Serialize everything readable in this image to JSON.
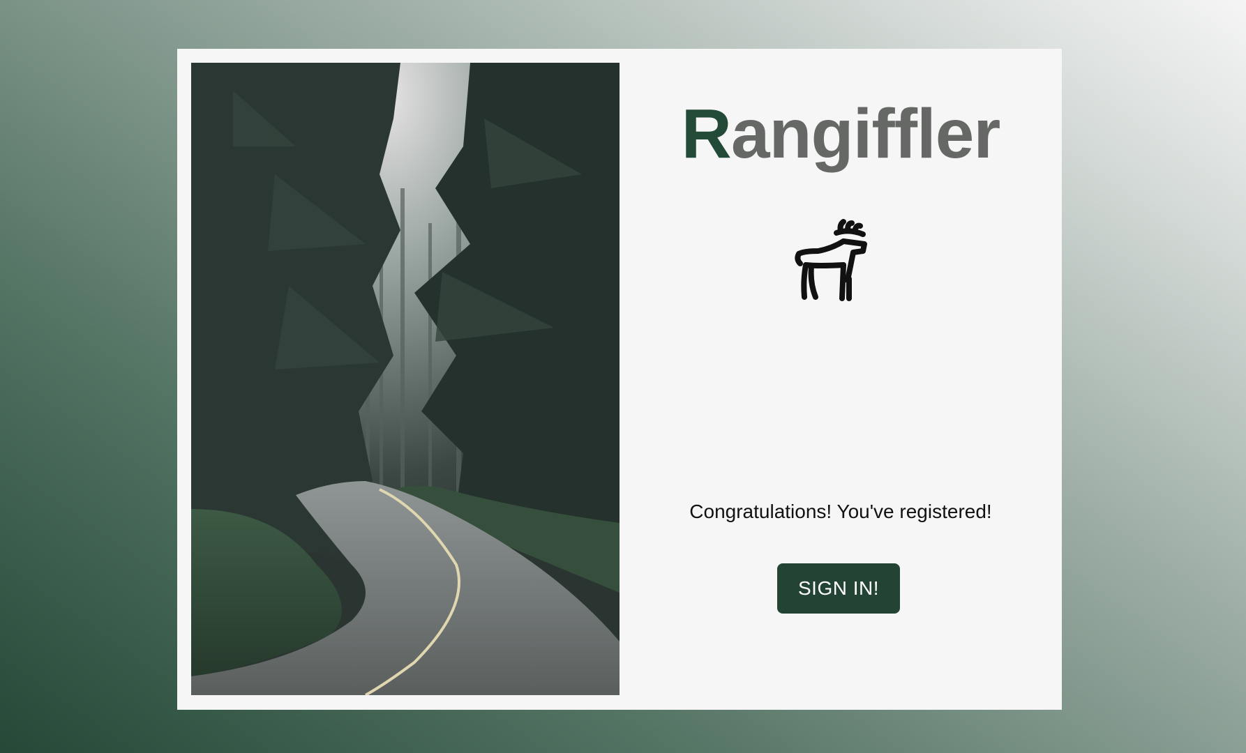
{
  "brand": {
    "initial": "R",
    "rest": "angiffler",
    "initial_color": "#234a36",
    "rest_color": "#666866"
  },
  "logo": {
    "icon": "reindeer-icon"
  },
  "hero_image": {
    "subject": "forest-road-photo"
  },
  "message": "Congratulations! You've registered!",
  "signin_button": {
    "label": "SIGN IN!",
    "color": "#234434"
  },
  "colors": {
    "background_dark": "#254837",
    "background_light": "#f5f5f5",
    "card": "#f6f6f6"
  }
}
